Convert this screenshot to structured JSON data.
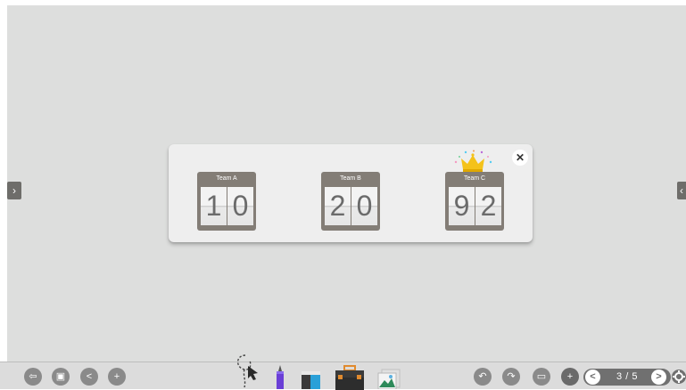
{
  "scoreboard": {
    "close_label": "✕",
    "teams": [
      {
        "name": "Team A",
        "digits": [
          "1",
          "0"
        ]
      },
      {
        "name": "Team B",
        "digits": [
          "2",
          "0"
        ]
      },
      {
        "name": "Team C",
        "digits": [
          "9",
          "2"
        ]
      }
    ],
    "leader_icon": "crown-icon",
    "colors": {
      "board": "#837d76",
      "panel": "#eeeeee",
      "canvas": "#dddedd",
      "crown": "#f4c21a"
    }
  },
  "navigation": {
    "prev_panel_label": "›",
    "next_panel_label": "‹"
  },
  "toolbar": {
    "left_buttons": [
      {
        "icon": "exit-icon",
        "glyph": "⇦"
      },
      {
        "icon": "save-icon",
        "glyph": "▣"
      },
      {
        "icon": "share-icon",
        "glyph": "<"
      },
      {
        "icon": "add-user-icon",
        "glyph": "+"
      }
    ],
    "tools": [
      "lasso-select-icon",
      "pen-icon",
      "eraser-icon",
      "toolbox-icon",
      "image-icon"
    ],
    "right_buttons": [
      {
        "icon": "undo-icon",
        "glyph": "↶"
      },
      {
        "icon": "redo-icon",
        "glyph": "↷"
      },
      {
        "icon": "window-icon",
        "glyph": "▭"
      },
      {
        "icon": "add-page-icon",
        "glyph": "+"
      }
    ],
    "pager": {
      "prev_label": "<",
      "text": "3 / 5",
      "next_label": ">"
    },
    "settings_icon": "settings-icon"
  }
}
